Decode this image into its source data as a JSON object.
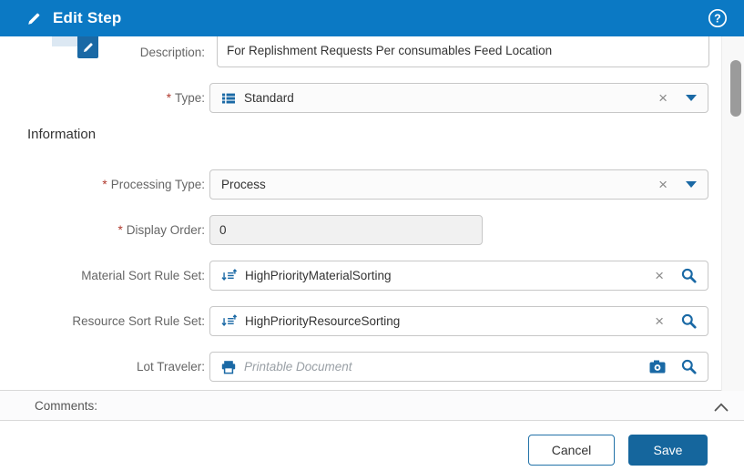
{
  "header": {
    "title": "Edit Step"
  },
  "glyphs": {
    "clear": "×",
    "required": "*"
  },
  "form": {
    "description": {
      "label": "Description:",
      "value": "For Replishment Requests Per consumables Feed Location"
    },
    "type": {
      "label": "Type:",
      "value": "Standard",
      "required": true
    },
    "information_heading": "Information",
    "processing_type": {
      "label": "Processing Type:",
      "value": "Process",
      "required": true
    },
    "display_order": {
      "label": "Display Order:",
      "value": "0",
      "required": true
    },
    "material_sort_rule_set": {
      "label": "Material Sort Rule Set:",
      "value": "HighPriorityMaterialSorting"
    },
    "resource_sort_rule_set": {
      "label": "Resource Sort Rule Set:",
      "value": "HighPriorityResourceSorting"
    },
    "lot_traveler": {
      "label": "Lot Traveler:",
      "placeholder": "Printable Document"
    },
    "comments": {
      "label": "Comments:"
    }
  },
  "footer": {
    "cancel_label": "Cancel",
    "save_label": "Save"
  },
  "icons": {
    "header_icon": "pencil-icon",
    "help_icon": "question-circle-icon",
    "type_icon": "list-icon",
    "sort_rule_icon": "sort-arrows-icon",
    "lot_traveler_icon": "printer-icon",
    "camera_icon": "camera-icon",
    "search_icon": "magnifier-icon",
    "clear_icon": "x-clear-icon",
    "dropdown_icon": "caret-down-icon",
    "collapse_icon": "chevron-up-icon"
  },
  "colors": {
    "header_bg": "#0b79c4",
    "accent_blue": "#1a69a5",
    "save_button_bg": "#15669d",
    "required_red": "#b03a2e",
    "spellcheck_red": "#e03131"
  }
}
